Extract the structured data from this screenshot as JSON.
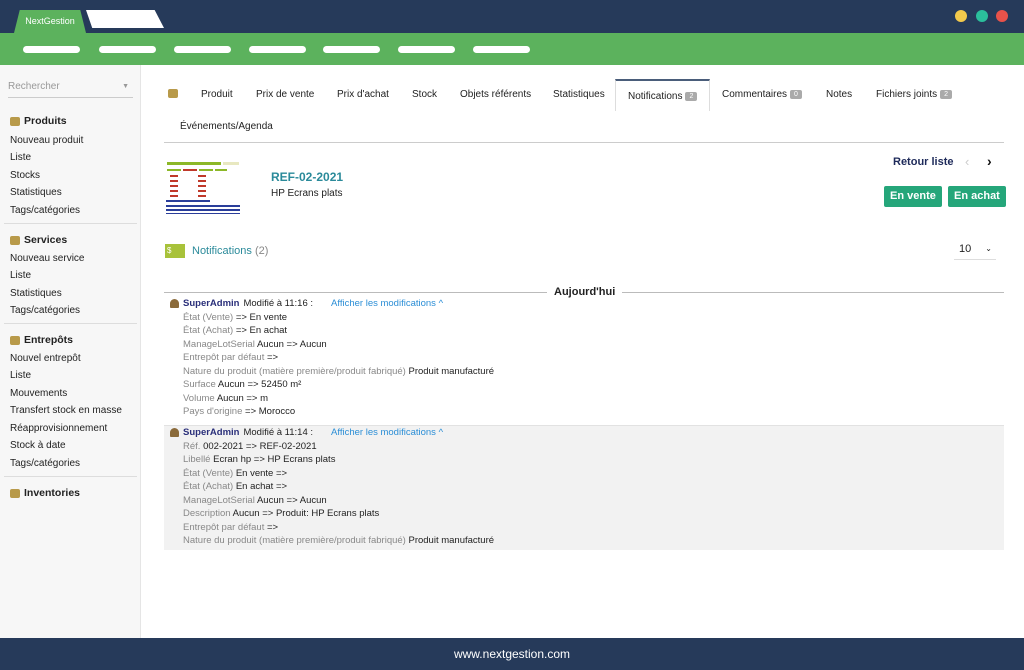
{
  "app": {
    "tab": "NextGestion",
    "footer": "www.nextgestion.com"
  },
  "sidebar": {
    "search_placeholder": "Rechercher",
    "sections": [
      {
        "title": "Produits",
        "items": [
          "Nouveau produit",
          "Liste",
          "Stocks",
          "Statistiques",
          "Tags/catégories"
        ]
      },
      {
        "title": "Services",
        "items": [
          "Nouveau service",
          "Liste",
          "Statistiques",
          "Tags/catégories"
        ]
      },
      {
        "title": "Entrepôts",
        "items": [
          "Nouvel entrepôt",
          "Liste",
          "Mouvements",
          "Transfert stock en masse",
          "Réapprovisionnement",
          "Stock à date",
          "Tags/catégories"
        ]
      },
      {
        "title": "Inventories",
        "items": []
      }
    ]
  },
  "tabs": [
    {
      "label": "Produit"
    },
    {
      "label": "Prix de vente"
    },
    {
      "label": "Prix d'achat"
    },
    {
      "label": "Stock"
    },
    {
      "label": "Objets référents"
    },
    {
      "label": "Statistiques"
    },
    {
      "label": "Notifications",
      "badge": "2"
    },
    {
      "label": "Commentaires",
      "badge": "0"
    },
    {
      "label": "Notes"
    },
    {
      "label": "Fichiers joints",
      "badge": "2"
    },
    {
      "label": "Événements/Agenda"
    }
  ],
  "product": {
    "ref": "REF-02-2021",
    "label": "HP Ecrans plats",
    "back": "Retour liste",
    "status_sell": "En vente",
    "status_buy": "En achat"
  },
  "notifications": {
    "title": "Notifications",
    "count": "(2)",
    "page_size": "10",
    "day": "Aujourd'hui",
    "entries": [
      {
        "user": "SuperAdmin",
        "action": "Modifié à 11:16 :",
        "link": "Afficher les modifications",
        "changes": [
          {
            "label": "État (Vente)",
            "value": " => En vente"
          },
          {
            "label": "État (Achat)",
            "value": " => En achat"
          },
          {
            "label": "ManageLotSerial",
            "value": "Aucun => Aucun"
          },
          {
            "label": "Entrepôt par défaut",
            "value": " =>"
          },
          {
            "label": "Nature du produit (matière première/produit fabriqué)",
            "value": "Produit manufacturé"
          },
          {
            "label": "Surface",
            "value": "Aucun => 52450 m²"
          },
          {
            "label": "Volume",
            "value": "Aucun => m"
          },
          {
            "label": "Pays d'origine",
            "value": " => Morocco"
          }
        ]
      },
      {
        "user": "SuperAdmin",
        "action": "Modifié à 11:14 :",
        "link": "Afficher les modifications",
        "changes": [
          {
            "label": "Réf.",
            "value": "002-2021 => REF-02-2021"
          },
          {
            "label": "Libellé",
            "value": "Ecran hp => HP Ecrans plats"
          },
          {
            "label": "État (Vente)",
            "value": "En vente =>"
          },
          {
            "label": "État (Achat)",
            "value": "En achat =>"
          },
          {
            "label": "ManageLotSerial",
            "value": "Aucun => Aucun"
          },
          {
            "label": "Description",
            "value": "Aucun => Produit: HP Ecrans plats"
          },
          {
            "label": "Entrepôt par défaut",
            "value": " =>"
          },
          {
            "label": "Nature du produit (matière première/produit fabriqué)",
            "value": "Produit manufacturé"
          }
        ]
      }
    ]
  }
}
